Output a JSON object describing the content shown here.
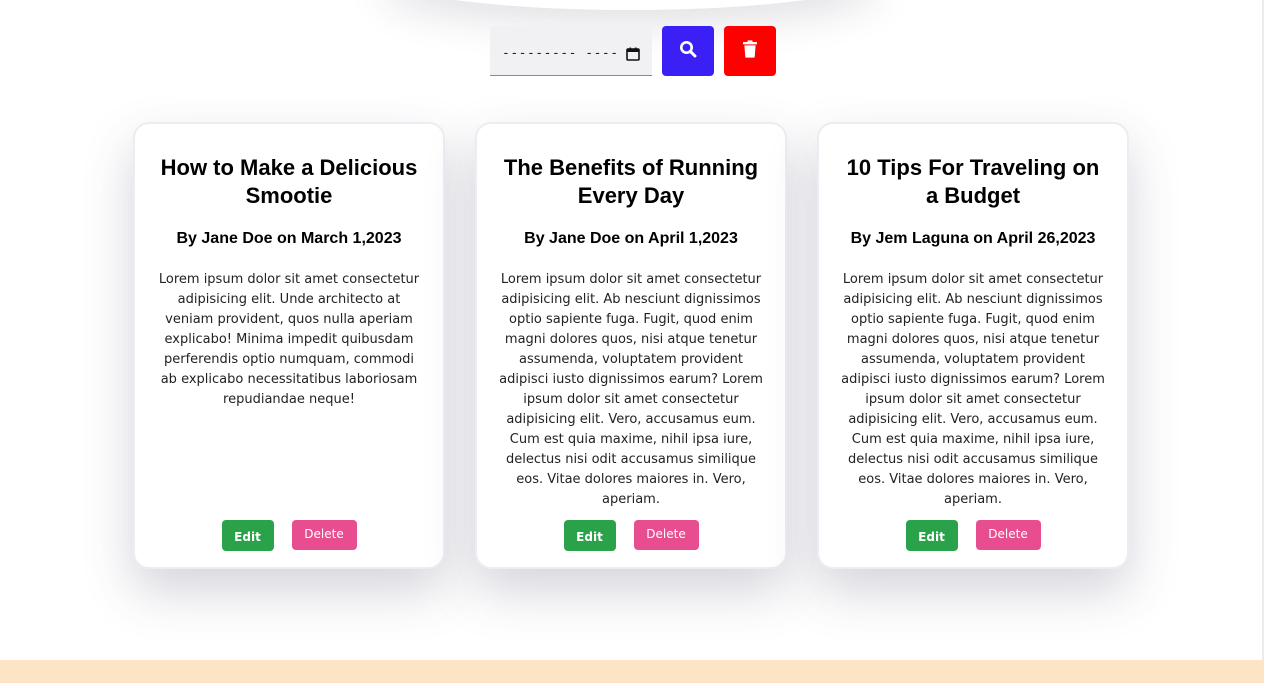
{
  "toolbar": {
    "date_placeholder": "--------- ----",
    "search_icon": "search-icon",
    "delete_icon": "trash-icon",
    "search_color": "#3a20f5",
    "delete_color": "#ff0000"
  },
  "posts": [
    {
      "title": "How to Make a Delicious Smootie",
      "meta": "By Jane Doe on March 1,2023",
      "body": "Lorem ipsum dolor sit amet consectetur adipisicing elit. Unde architecto at veniam provident, quos nulla aperiam explicabo! Minima impedit quibusdam perferendis optio numquam, commodi ab explicabo necessitatibus laboriosam repudiandae neque!",
      "edit_label": "Edit",
      "delete_label": "Delete"
    },
    {
      "title": "The Benefits of Running Every Day",
      "meta": "By Jane Doe on April 1,2023",
      "body": "Lorem ipsum dolor sit amet consectetur adipisicing elit. Ab nesciunt dignissimos optio sapiente fuga. Fugit, quod enim magni dolores quos, nisi atque tenetur assumenda, voluptatem provident adipisci iusto dignissimos earum? Lorem ipsum dolor sit amet consectetur adipisicing elit. Vero, accusamus eum. Cum est quia maxime, nihil ipsa iure, delectus nisi odit accusamus similique eos. Vitae dolores maiores in. Vero, aperiam.",
      "edit_label": "Edit",
      "delete_label": "Delete"
    },
    {
      "title": "10 Tips For Traveling on a Budget",
      "meta": "By Jem Laguna on April 26,2023",
      "body": "Lorem ipsum dolor sit amet consectetur adipisicing elit. Ab nesciunt dignissimos optio sapiente fuga. Fugit, quod enim magni dolores quos, nisi atque tenetur assumenda, voluptatem provident adipisci iusto dignissimos earum? Lorem ipsum dolor sit amet consectetur adipisicing elit. Vero, accusamus eum. Cum est quia maxime, nihil ipsa iure, delectus nisi odit accusamus similique eos. Vitae dolores maiores in. Vero, aperiam.",
      "edit_label": "Edit",
      "delete_label": "Delete"
    }
  ],
  "colors": {
    "edit_button": "#2aa24a",
    "delete_button": "#e84d8f",
    "footer_band": "#fde4c4"
  }
}
